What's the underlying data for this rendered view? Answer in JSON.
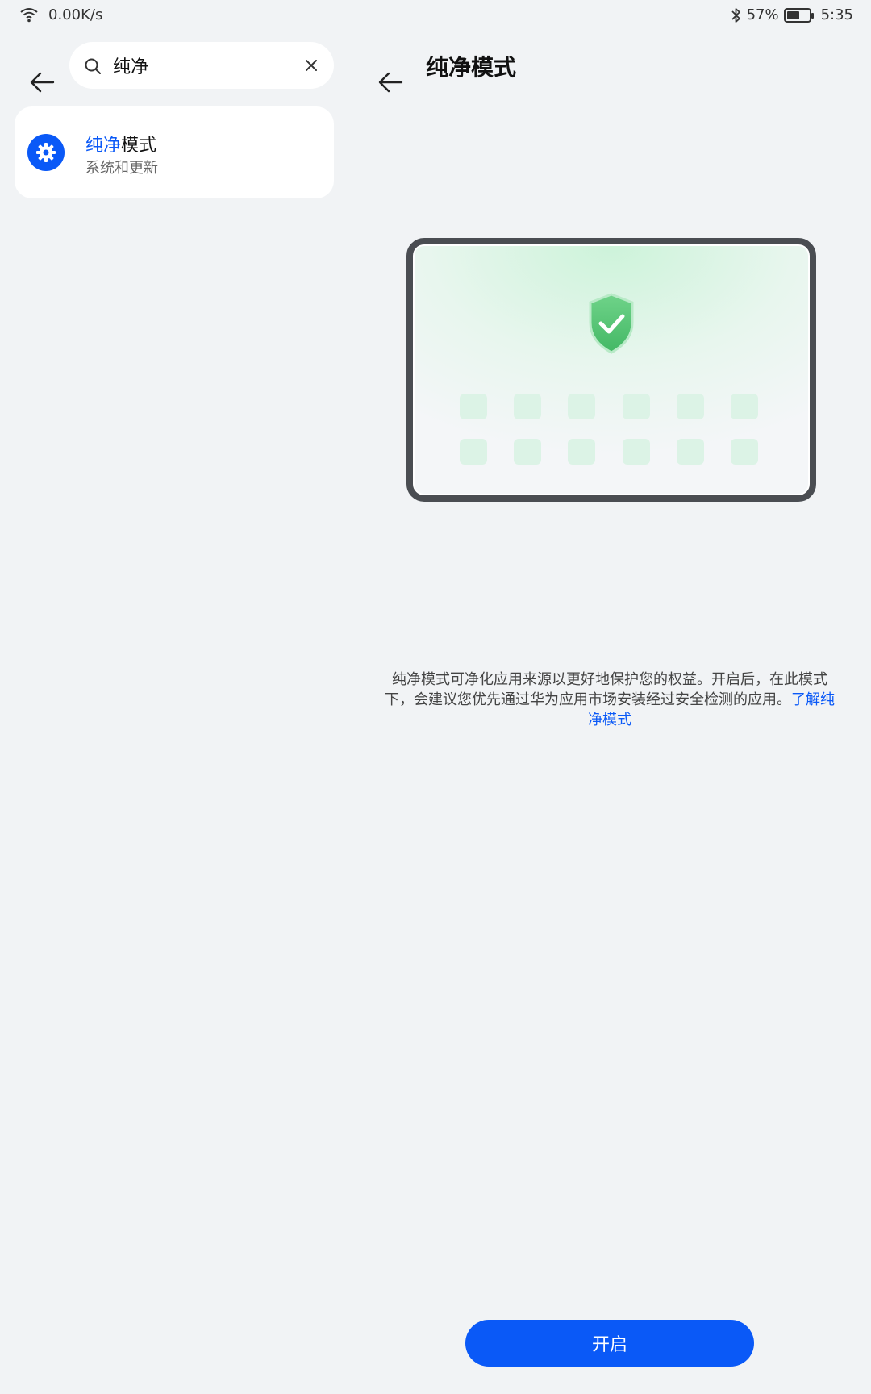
{
  "status_bar": {
    "network_speed": "0.00K/s",
    "battery_percent": "57%",
    "battery_level": 0.57,
    "time": "5:35"
  },
  "left_pane": {
    "search": {
      "value": "纯净",
      "placeholder": ""
    },
    "results": [
      {
        "title_highlight": "纯净",
        "title_rest": "模式",
        "subtitle": "系统和更新",
        "icon": "gear-icon"
      }
    ]
  },
  "right_pane": {
    "title": "纯净模式",
    "illustration_icon": "shield-check-icon",
    "description": "纯净模式可净化应用来源以更好地保护您的权益。开启后，在此模式下，会建议您优先通过华为应用市场安装经过安全检测的应用。",
    "learn_more": "了解纯净模式",
    "enable_button": "开启"
  },
  "colors": {
    "accent": "#0a59f7",
    "background": "#f1f3f5",
    "card": "#ffffff",
    "shield": "#5cc97a"
  }
}
